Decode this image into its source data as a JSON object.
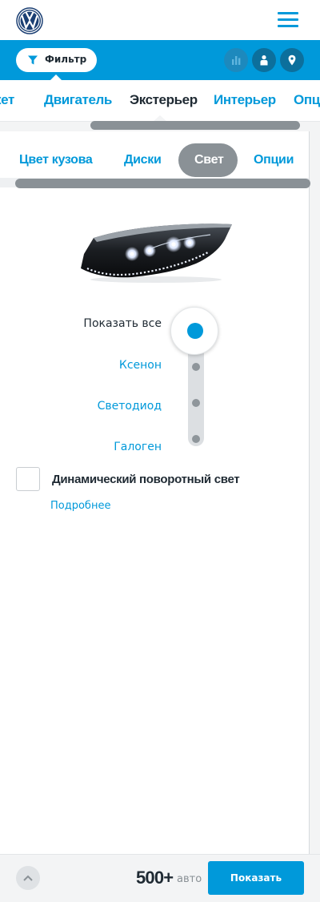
{
  "header": {
    "logo_icon": "volkswagen-logo",
    "menu_icon": "hamburger-menu-icon",
    "brand_color": "#0099da"
  },
  "filterbar": {
    "filter_label": "Фильтр",
    "filter_icon": "funnel-icon",
    "icons": [
      "bar-chart-icon",
      "person-icon",
      "map-pin-icon"
    ]
  },
  "category_tabs": {
    "items": [
      {
        "label": "Пакет"
      },
      {
        "label": "Двигатель"
      },
      {
        "label": "Экстерьер"
      },
      {
        "label": "Интерьер"
      },
      {
        "label": "Опции"
      }
    ],
    "visible_labels": [
      "кет",
      "Двигатель",
      "Экстерьер",
      "Интерьер",
      "Опц"
    ],
    "active_index": 2
  },
  "sub_tabs": {
    "items": [
      {
        "label": "Цвет кузова"
      },
      {
        "label": "Диски"
      },
      {
        "label": "Свет"
      },
      {
        "label": "Опции"
      }
    ],
    "active_index": 2
  },
  "light_options": {
    "image": "headlight-image",
    "items": [
      {
        "label": "Показать все"
      },
      {
        "label": "Ксенон"
      },
      {
        "label": "Светодиод"
      },
      {
        "label": "Галоген"
      }
    ],
    "selected_index": 0
  },
  "dynamic_light": {
    "label": "Динамический поворотный свет",
    "checked": false,
    "more_link": "Подробнее"
  },
  "footer": {
    "scroll_top_icon": "chevron-up-icon",
    "count": "500+",
    "count_unit": "авто",
    "show_button": "Показать"
  }
}
